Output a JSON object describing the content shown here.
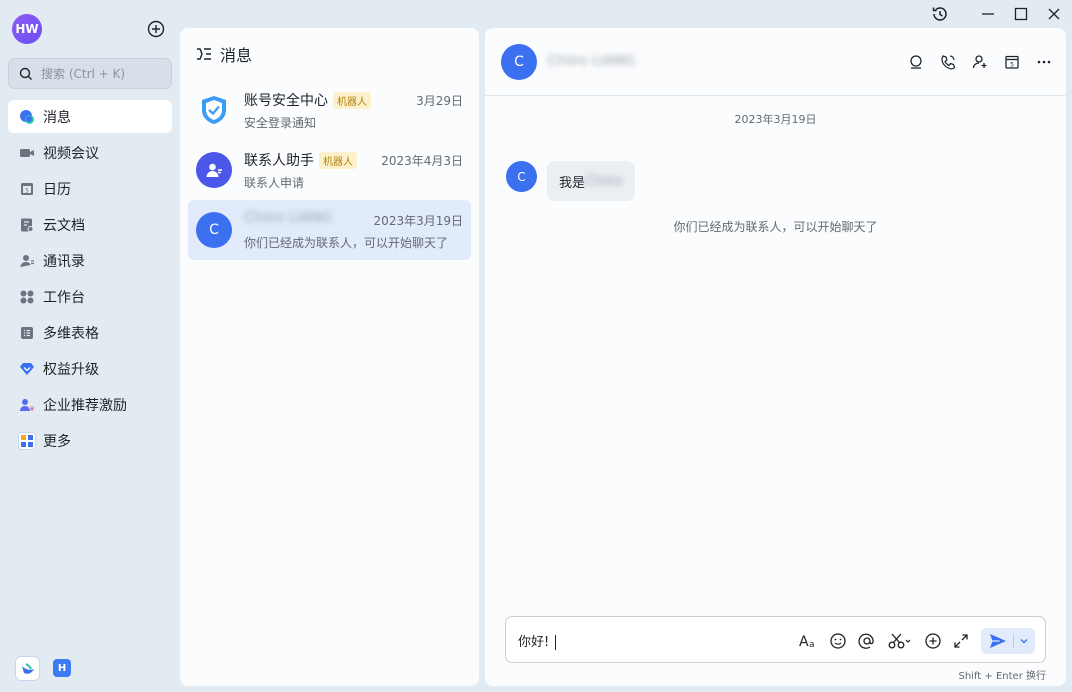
{
  "user": {
    "initials": "HW"
  },
  "search": {
    "placeholder": "搜索 (Ctrl + K)"
  },
  "sidebar": {
    "items": [
      {
        "label": "消息",
        "icon": "message-icon",
        "active": true
      },
      {
        "label": "视频会议",
        "icon": "video-icon"
      },
      {
        "label": "日历",
        "icon": "calendar-icon"
      },
      {
        "label": "云文档",
        "icon": "doc-icon"
      },
      {
        "label": "通讯录",
        "icon": "contacts-icon"
      },
      {
        "label": "工作台",
        "icon": "workbench-icon"
      },
      {
        "label": "多维表格",
        "icon": "table-icon"
      },
      {
        "label": "权益升级",
        "icon": "diamond-icon"
      },
      {
        "label": "企业推荐激励",
        "icon": "referral-icon"
      },
      {
        "label": "更多",
        "icon": "more-apps-icon"
      }
    ],
    "bottom_app": "H"
  },
  "conversations": {
    "title": "消息",
    "items": [
      {
        "name": "账号安全中心",
        "tag": "机器人",
        "time": "3月29日",
        "preview": "安全登录通知",
        "avatar": "shield"
      },
      {
        "name": "联系人助手",
        "tag": "机器人",
        "time": "2023年4月3日",
        "preview": "联系人申请",
        "avatar": "contact-assistant"
      },
      {
        "name": "Chiiro LIANG",
        "tag": "",
        "time": "2023年3月19日",
        "preview": "你们已经成为联系人，可以开始聊天了",
        "avatar_letter": "C",
        "selected": true
      }
    ]
  },
  "chat": {
    "contact_name": "Chiiro LIANG",
    "avatar_letter": "C",
    "date_separator": "2023年3月19日",
    "messages": [
      {
        "sender_letter": "C",
        "text_prefix": "我是",
        "text_blurred": "Chiiro"
      }
    ],
    "system_message": "你们已经成为联系人，可以开始聊天了",
    "composer_text": "你好!",
    "send_hint": "Shift + Enter 换行"
  },
  "colors": {
    "accent": "#3b71f0",
    "selected_bg": "#e1ebfb",
    "bot_tag_bg": "#fdf1cc",
    "bot_tag_text": "#b5830e"
  }
}
